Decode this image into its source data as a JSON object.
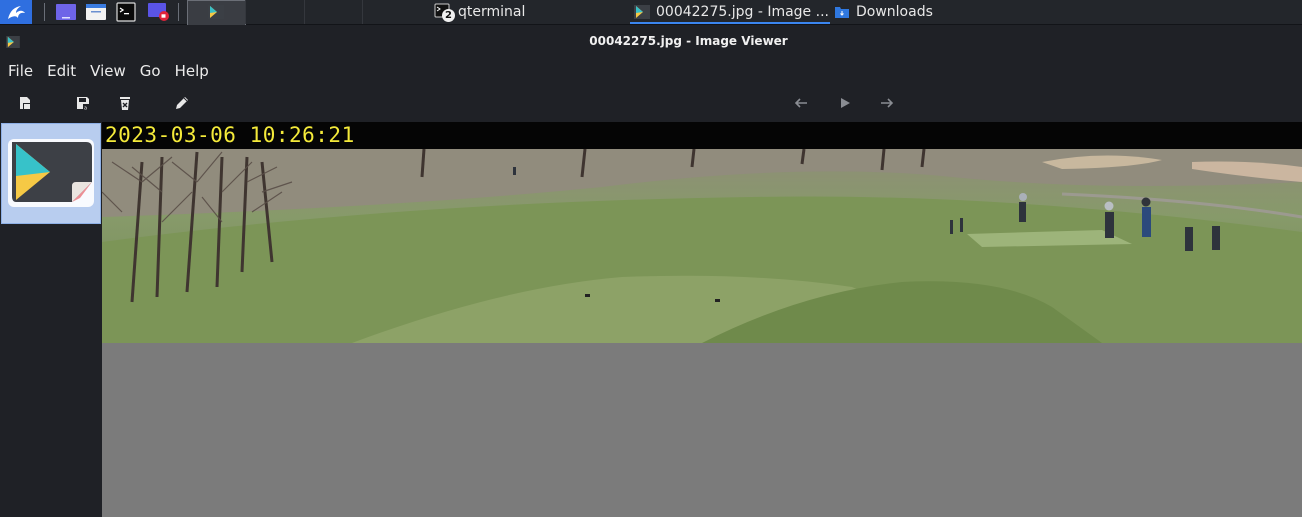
{
  "taskbar": {
    "apps": [
      {
        "label": "qterminal",
        "badge": "2"
      },
      {
        "label": "00042275.jpg - Image ..."
      },
      {
        "label": "Downloads"
      }
    ]
  },
  "window": {
    "title": "00042275.jpg - Image Viewer"
  },
  "menu": [
    "File",
    "Edit",
    "View",
    "Go",
    "Help"
  ],
  "image": {
    "timestamp": "2023-03-06 10:26:21"
  }
}
